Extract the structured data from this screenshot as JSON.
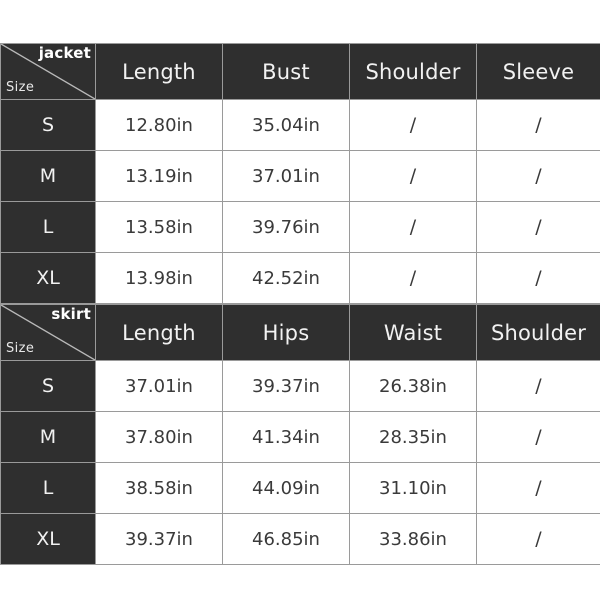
{
  "page": {
    "background_color": "#ffffff",
    "dark_cell_color": "#2f2f2f",
    "light_cell_color": "#ffffff",
    "grid_line_color": "#9a9a9a",
    "text_light": "#f2f2f2",
    "text_dark": "#3a3a3a"
  },
  "tables": [
    {
      "corner": {
        "category_label": "jacket",
        "size_label": "Size"
      },
      "columns": [
        "Length",
        "Bust",
        "Shoulder",
        "Sleeve"
      ],
      "rows": [
        {
          "size": "S",
          "values": [
            "12.80in",
            "35.04in",
            "/",
            "/"
          ]
        },
        {
          "size": "M",
          "values": [
            "13.19in",
            "37.01in",
            "/",
            "/"
          ]
        },
        {
          "size": "L",
          "values": [
            "13.58in",
            "39.76in",
            "/",
            "/"
          ]
        },
        {
          "size": "XL",
          "values": [
            "13.98in",
            "42.52in",
            "/",
            "/"
          ]
        }
      ]
    },
    {
      "corner": {
        "category_label": "skirt",
        "size_label": "Size"
      },
      "columns": [
        "Length",
        "Hips",
        "Waist",
        "Shoulder"
      ],
      "rows": [
        {
          "size": "S",
          "values": [
            "37.01in",
            "39.37in",
            "26.38in",
            "/"
          ]
        },
        {
          "size": "M",
          "values": [
            "37.80in",
            "41.34in",
            "28.35in",
            "/"
          ]
        },
        {
          "size": "L",
          "values": [
            "38.58in",
            "44.09in",
            "31.10in",
            "/"
          ]
        },
        {
          "size": "XL",
          "values": [
            "39.37in",
            "46.85in",
            "33.86in",
            "/"
          ]
        }
      ]
    }
  ]
}
